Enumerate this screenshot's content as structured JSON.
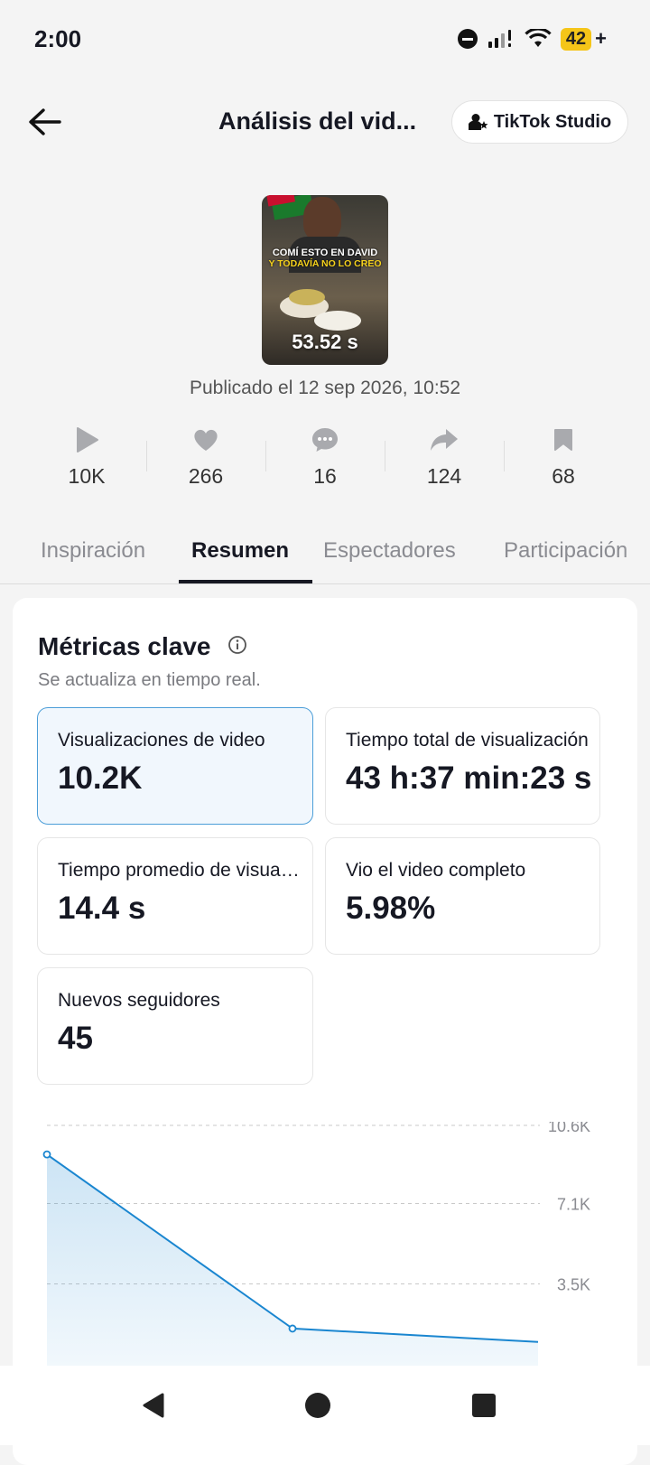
{
  "status_bar": {
    "time": "2:00",
    "battery": "42"
  },
  "header": {
    "title": "Análisis del vid...",
    "studio_button": "TikTok Studio"
  },
  "video": {
    "overlay_line1": "COMÍ ESTO EN DAVID",
    "overlay_line2": "Y TODAVÍA NO LO CREO",
    "duration": "53.52 s",
    "published": "Publicado el 12 sep 2026, 10:52"
  },
  "stats": [
    {
      "icon": "play-icon",
      "value": "10K"
    },
    {
      "icon": "heart-icon",
      "value": "266"
    },
    {
      "icon": "comment-icon",
      "value": "16"
    },
    {
      "icon": "share-icon",
      "value": "124"
    },
    {
      "icon": "bookmark-icon",
      "value": "68"
    }
  ],
  "tabs": [
    {
      "label": "Inspiración",
      "active": false
    },
    {
      "label": "Resumen",
      "active": true
    },
    {
      "label": "Espectadores",
      "active": false
    },
    {
      "label": "Participación",
      "active": false
    }
  ],
  "metrics_card": {
    "title": "Métricas clave",
    "subtitle": "Se actualiza en tiempo real.",
    "metrics": [
      {
        "label": "Visualizaciones de video",
        "value": "10.2K",
        "selected": true
      },
      {
        "label": "Tiempo total de visualización",
        "value": "43 h:37 min:23 s",
        "selected": false
      },
      {
        "label": "Tiempo promedio de visualización",
        "value": "14.4 s",
        "selected": false
      },
      {
        "label": "Vio el video completo",
        "value": "5.98%",
        "selected": false
      },
      {
        "label": "Nuevos seguidores",
        "value": "45",
        "selected": false
      }
    ]
  },
  "chart_data": {
    "type": "area",
    "y_tick_labels": [
      "10.6K",
      "7.1K",
      "3.5K"
    ],
    "y_ticks": [
      10600,
      7100,
      3500
    ],
    "ylim": [
      0,
      10600
    ],
    "grid": true,
    "series": [
      {
        "values": [
          9300,
          1500,
          900
        ]
      }
    ],
    "color": "#1a86d0"
  },
  "colors": {
    "accent": "#1a86d0",
    "selected_bg": "#f1f7fd",
    "selected_border": "#4c9ed8"
  }
}
